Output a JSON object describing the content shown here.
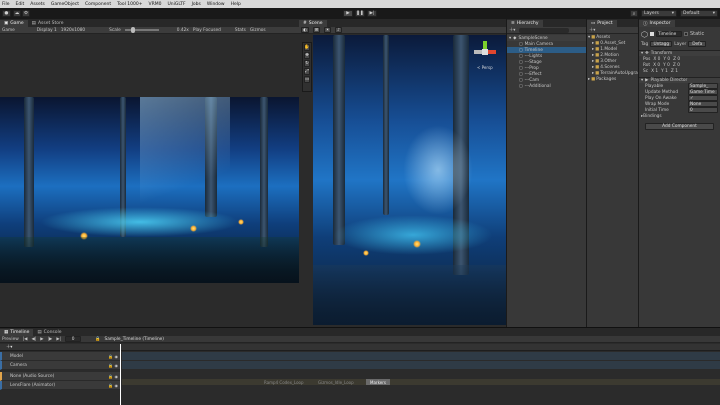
{
  "menu": [
    "File",
    "Edit",
    "Assets",
    "GameObject",
    "Component",
    "Tool 1000+",
    "VRM0",
    "UniGLTF",
    "Jobs",
    "Window",
    "Help"
  ],
  "toolbar": {
    "layers_label": "Layers",
    "layout_label": "Default"
  },
  "game": {
    "tab_game": "Game",
    "tab_asset_store": "Asset Store",
    "view_mode": "Game",
    "display": "Display 1",
    "resolution": "1920x1080",
    "scale_label": "Scale",
    "scale_value": "0.42x",
    "focus_mode": "Play Focused",
    "stats_label": "Stats",
    "gizmos_label": "Gizmos"
  },
  "scene": {
    "tab": "Scene",
    "persp_label": "< Persp"
  },
  "hierarchy": {
    "tab": "Hierarchy",
    "scene_name": "SampleScene",
    "items": [
      "Main Camera",
      "Timeline",
      "---Lights",
      "---Stage",
      "---Prop",
      "---Effect",
      "---Cam",
      "---Additional"
    ]
  },
  "project": {
    "tab": "Project",
    "root": "Assets",
    "items": [
      "0.Asset_Set",
      "1.Model",
      "2.Motion",
      "3.Other",
      "4.Scenes",
      "TerrainAutoUpgrade"
    ],
    "packages": "Packages"
  },
  "inspector": {
    "tab": "Inspector",
    "object_name": "Timeline",
    "static_label": "Static",
    "tag_label": "Tag",
    "tag_value": "Untagg",
    "layer_label": "Layer",
    "layer_value": "Defa",
    "transform_title": "Transform",
    "pos_label": "Pos",
    "rot_label": "Rot",
    "scale_label": "Sc",
    "pos": {
      "x": "0",
      "y": "0",
      "z": "0"
    },
    "rot": {
      "x": "0",
      "y": "0",
      "z": "0"
    },
    "scl": {
      "x": "1",
      "y": "1",
      "z": "1"
    },
    "director_title": "Playable Director",
    "props": [
      {
        "label": "Playable",
        "value": "Sample_"
      },
      {
        "label": "Update Method",
        "value": "Game Time"
      },
      {
        "label": "Play On Awake",
        "value": "✓"
      },
      {
        "label": "Wrap Mode",
        "value": "None"
      },
      {
        "label": "Initial Time",
        "value": "0"
      }
    ],
    "bindings_label": "Bindings",
    "add_component": "Add Component"
  },
  "timeline": {
    "tab_timeline": "Timeline",
    "tab_console": "Console",
    "preview_label": "Preview",
    "frame": "0",
    "asset_name": "Sample_Timeline (Timeline)",
    "tracks": [
      {
        "name": "Model",
        "color": "#3a6ea5"
      },
      {
        "name": "Camera",
        "color": "#3a6ea5"
      },
      {
        "name": "None (Audio Source)",
        "color": "#e2a44a"
      },
      {
        "name": "LensFlare (Animator)",
        "color": "#3a6ea5"
      }
    ],
    "clip_labels": [
      "Ramp4 Codex_Loop",
      "Gizmos_Idle_Loop"
    ],
    "markers_label": "Markers"
  },
  "colors": {
    "accent": "#3a6ea5",
    "audio": "#e2a44a",
    "play_active": "#2f6db2"
  }
}
